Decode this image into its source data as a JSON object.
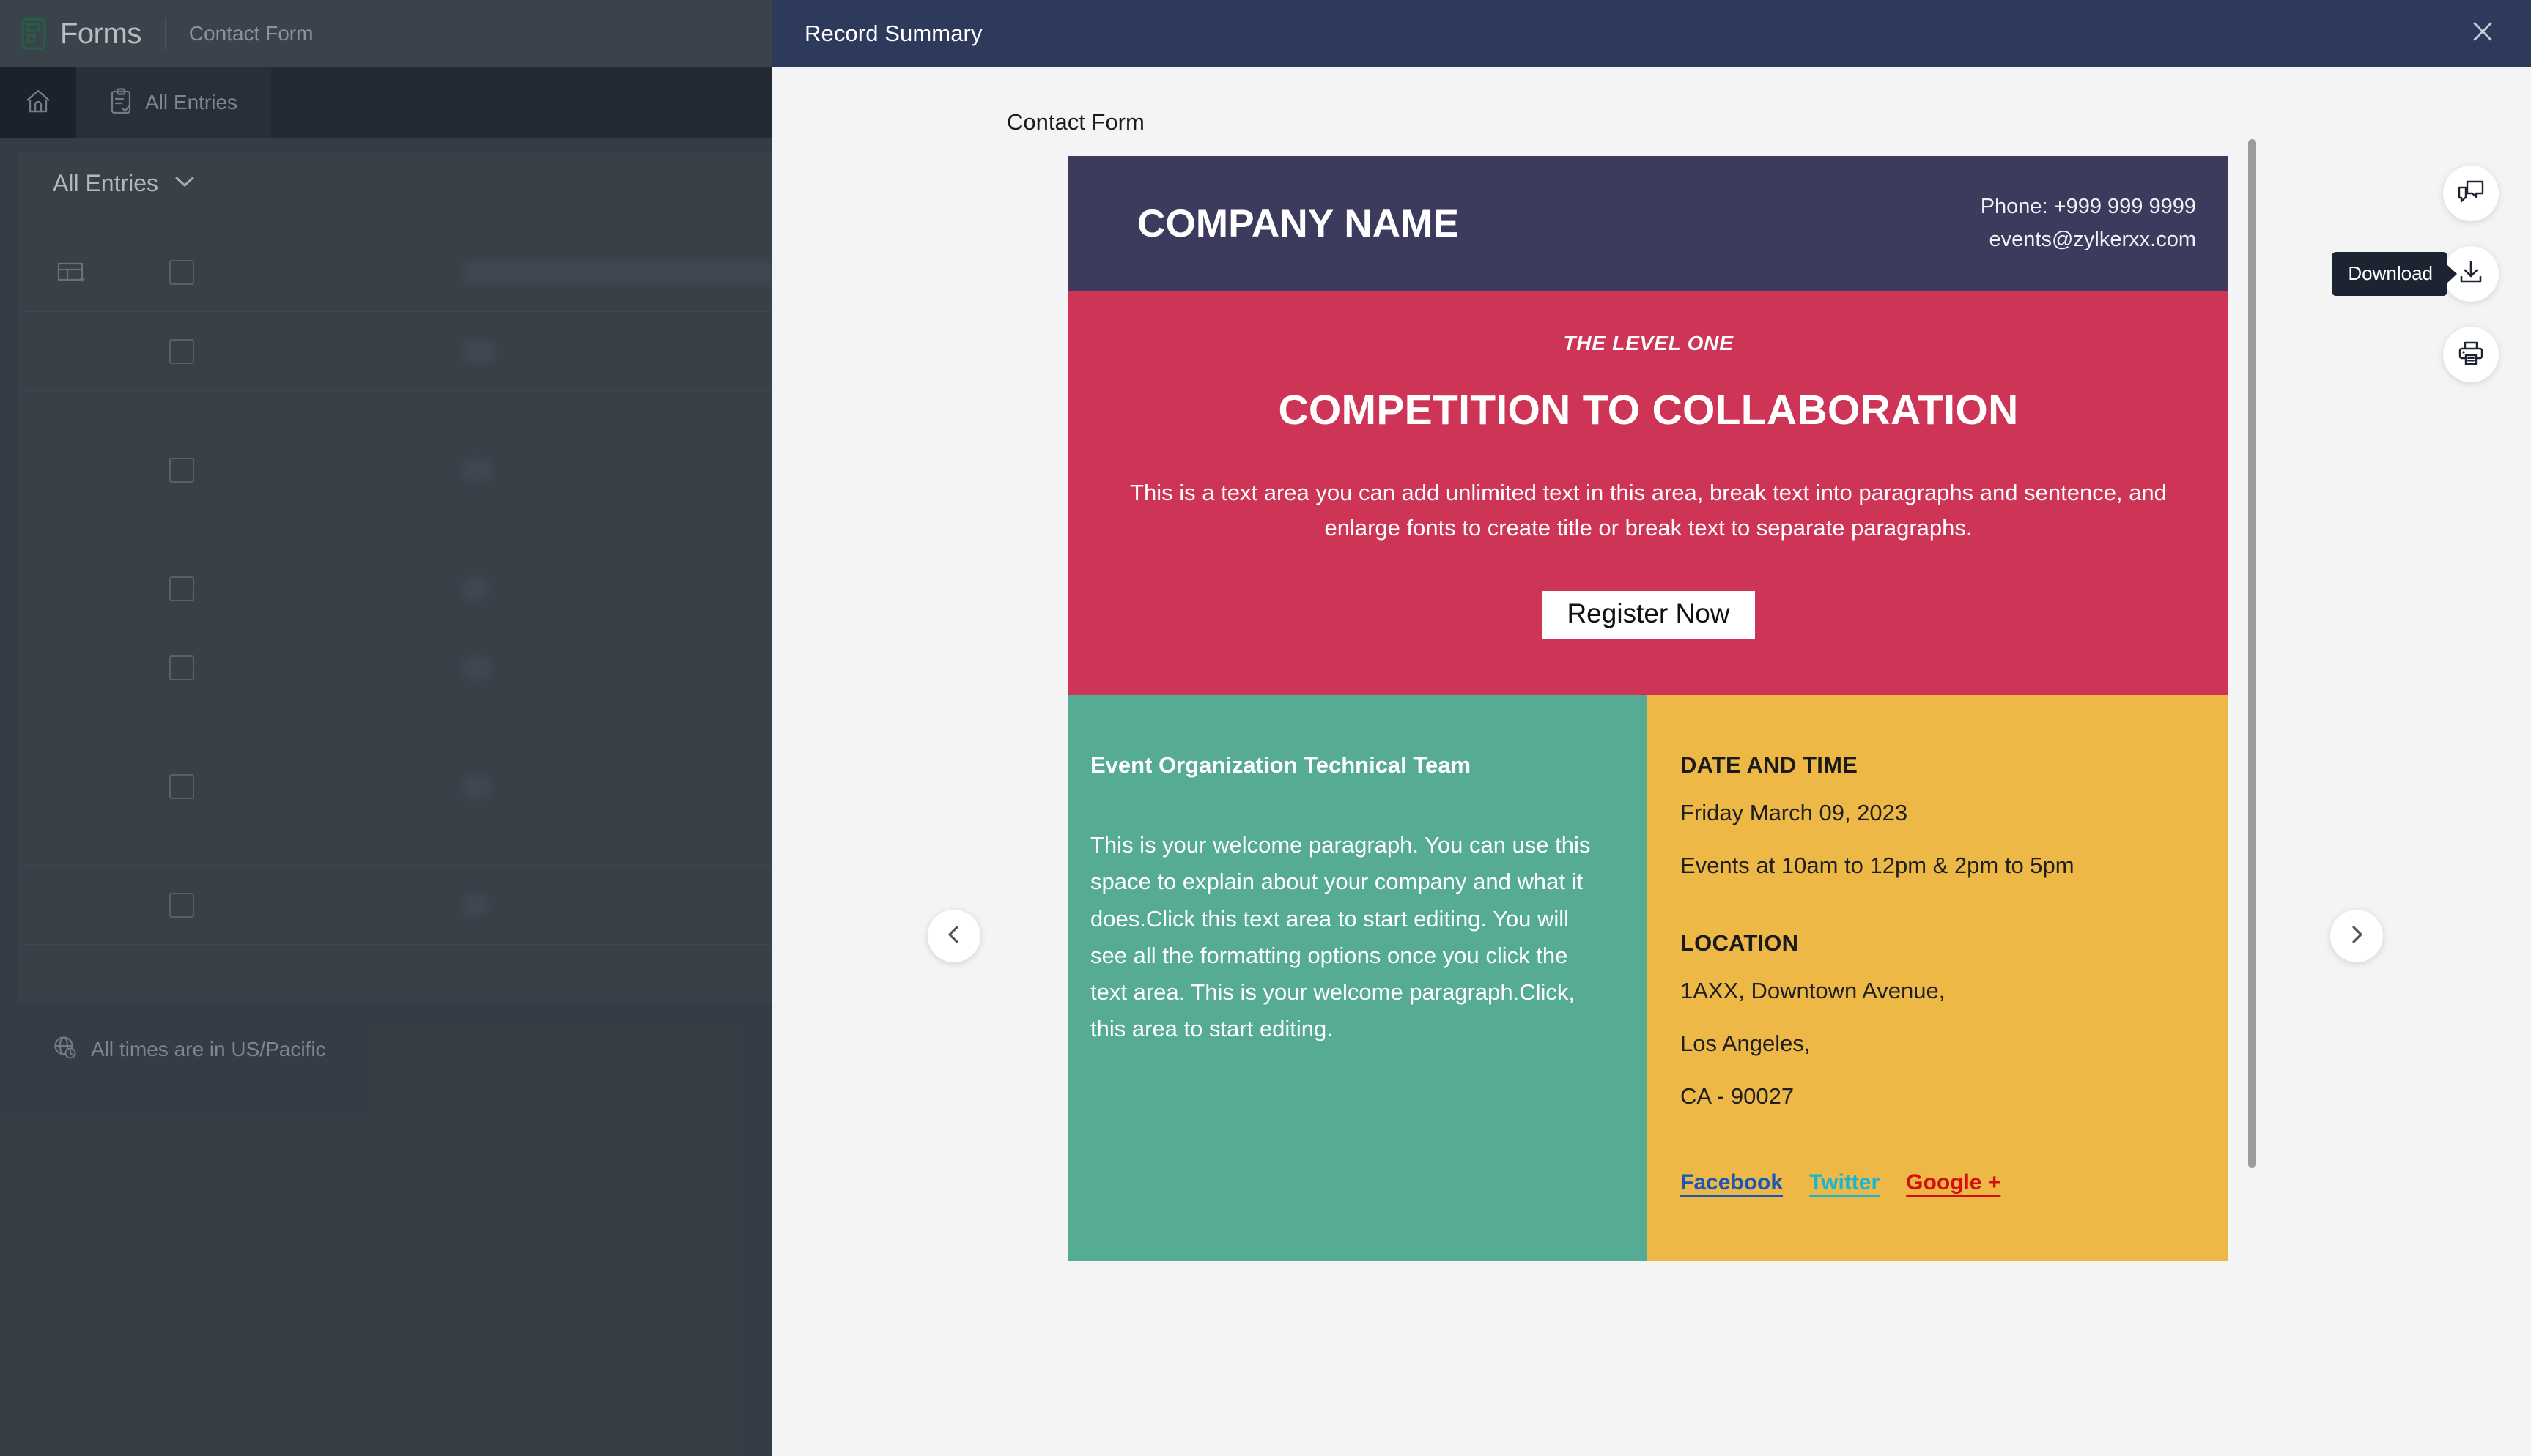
{
  "app": {
    "product_name": "Forms",
    "breadcrumb": "Contact Form",
    "logo_icon": "forms-logo-icon",
    "home_icon": "home-icon",
    "tab": {
      "label": "All Entries",
      "icon": "clipboard-check-icon"
    },
    "filter": {
      "label": "All Entries",
      "chevron_icon": "chevron-down-icon"
    },
    "grid": {
      "column_icon": "table-column-icon",
      "checkbox_icon": "checkbox-icon",
      "rows": [
        {
          "type": "header"
        },
        {
          "type": "row"
        },
        {
          "type": "row-tall"
        },
        {
          "type": "row"
        },
        {
          "type": "row"
        },
        {
          "type": "row-tall"
        },
        {
          "type": "row"
        }
      ]
    },
    "footer": {
      "globe_icon": "globe-clock-icon",
      "text": "All times are in US/Pacific"
    }
  },
  "modal": {
    "title": "Record Summary",
    "close_icon": "close-icon",
    "record_label": "Contact Form",
    "scrollbar": "vertical-scrollbar",
    "nav": {
      "prev_icon": "chevron-left-icon",
      "next_icon": "chevron-right-icon"
    },
    "actions": [
      {
        "name": "comment-button",
        "icon": "comment-bubbles-icon",
        "tooltip": null
      },
      {
        "name": "download-button",
        "icon": "download-icon",
        "tooltip": "Download"
      },
      {
        "name": "print-button",
        "icon": "print-icon",
        "tooltip": null
      }
    ]
  },
  "email_card": {
    "banner": {
      "company_name": "COMPANY NAME",
      "phone": "Phone: +999 999 9999",
      "email": "events@zylkerxx.com",
      "bg_color": "#3c3b5e"
    },
    "hero": {
      "kicker": "THE LEVEL ONE",
      "headline": "COMPETITION TO COLLABORATION",
      "body": "This is a text area you can add unlimited text in this area, break text into paragraphs and sentence, and enlarge fonts to create title or break text to separate  paragraphs.",
      "cta_label": "Register Now",
      "bg_color": "#ce3455"
    },
    "left_column": {
      "title": "Event Organization Technical Team",
      "body": "This is your welcome paragraph. You can use this space to explain about your company  and what it does.Click this text area to start editing. You will see all the formatting options once you click the  text area. This is your welcome paragraph.Click, this area to start editing.",
      "bg_color": "#56ab95"
    },
    "right_column": {
      "datetime_heading": "DATE AND TIME",
      "date_line": "Friday  March 09, 2023",
      "time_line": "Events at 10am to 12pm & 2pm to 5pm",
      "location_heading": "LOCATION",
      "address_line1": "1AXX, Downtown Avenue,",
      "address_line2": "Los Angeles,",
      "address_line3": "CA - 90027",
      "bg_color": "#edb845",
      "social_links": [
        {
          "label": "Facebook ",
          "color": "#1a56b8"
        },
        {
          "label": "Twitter  ",
          "color": "#16b7d4"
        },
        {
          "label": "Google + ",
          "color": "#d40f12"
        }
      ]
    }
  }
}
